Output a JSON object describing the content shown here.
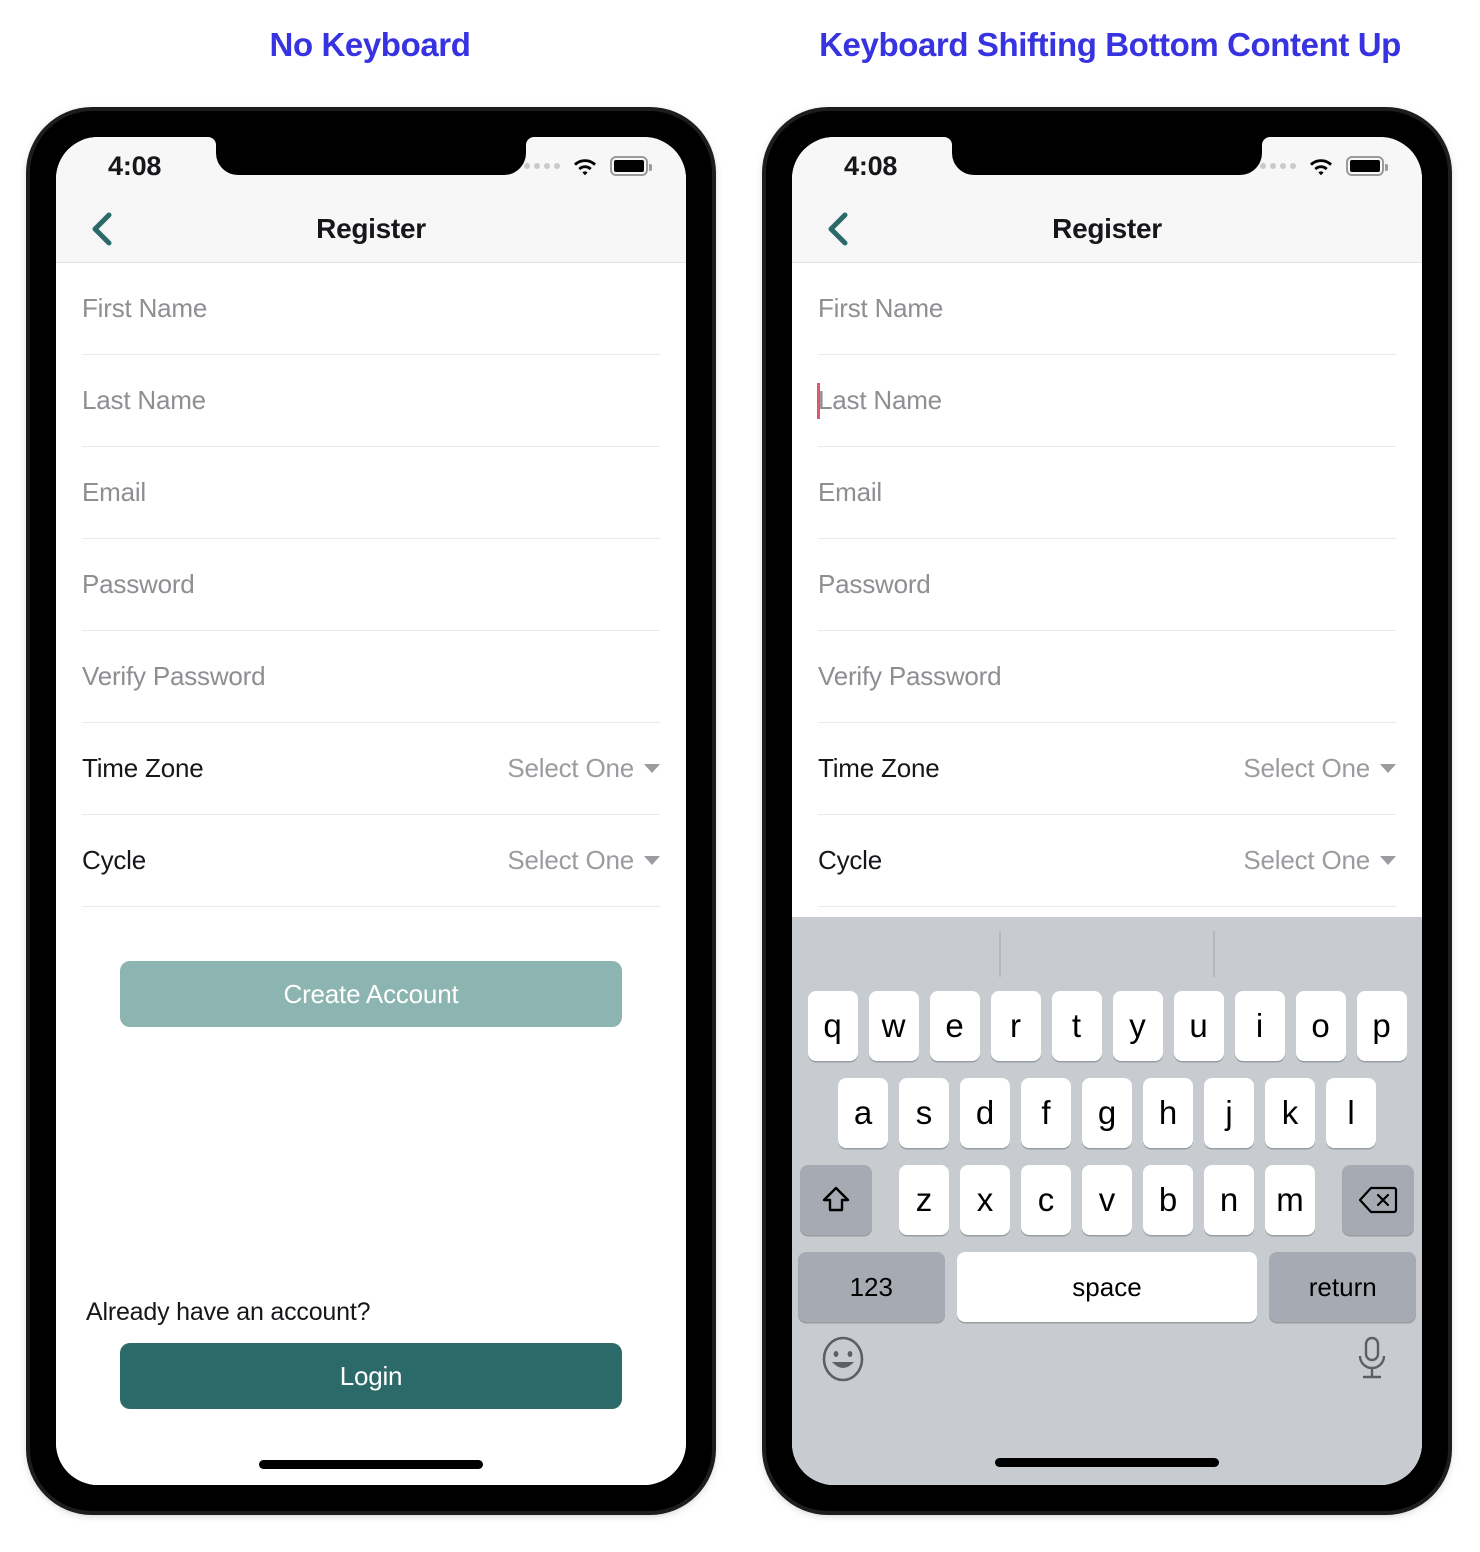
{
  "captions": {
    "left": "No Keyboard",
    "right": "Keyboard Shifting Bottom Content Up",
    "color": "#3733e0"
  },
  "status_bar": {
    "time": "4:08",
    "signal_icon": "signal-dots-icon",
    "wifi_icon": "wifi-icon",
    "battery_icon": "battery-icon"
  },
  "nav": {
    "back_icon": "chevron-left-icon",
    "title": "Register"
  },
  "form": {
    "fields": [
      {
        "name": "first-name",
        "placeholder": "First Name"
      },
      {
        "name": "last-name",
        "placeholder": "Last Name"
      },
      {
        "name": "email",
        "placeholder": "Email"
      },
      {
        "name": "password",
        "placeholder": "Password"
      },
      {
        "name": "verify-password",
        "placeholder": "Verify Password"
      }
    ],
    "pickers": [
      {
        "name": "time-zone",
        "label": "Time Zone",
        "value": "Select One"
      },
      {
        "name": "cycle",
        "label": "Cycle",
        "value": "Select One"
      }
    ],
    "create_account_label": "Create Account",
    "already_text": "Already have an account?",
    "login_label": "Login"
  },
  "colors": {
    "create_account_bg": "#8cb4b0",
    "login_bg": "#2b6a69",
    "accent_teal": "#2b6a69",
    "caret": "#e0576b",
    "keyboard_bg": "#c8cbd0",
    "key_bg": "#ffffff",
    "key_fn_bg": "#a6abb3"
  },
  "keyboard": {
    "row1": [
      "q",
      "w",
      "e",
      "r",
      "t",
      "y",
      "u",
      "i",
      "o",
      "p"
    ],
    "row2": [
      "a",
      "s",
      "d",
      "f",
      "g",
      "h",
      "j",
      "k",
      "l"
    ],
    "row3": [
      "z",
      "x",
      "c",
      "v",
      "b",
      "n",
      "m"
    ],
    "shift_icon": "shift-up-arrow-icon",
    "backspace_icon": "backspace-delete-icon",
    "numbers_label": "123",
    "space_label": "space",
    "return_label": "return",
    "emoji_icon": "emoji-smiley-icon",
    "mic_icon": "microphone-icon"
  }
}
